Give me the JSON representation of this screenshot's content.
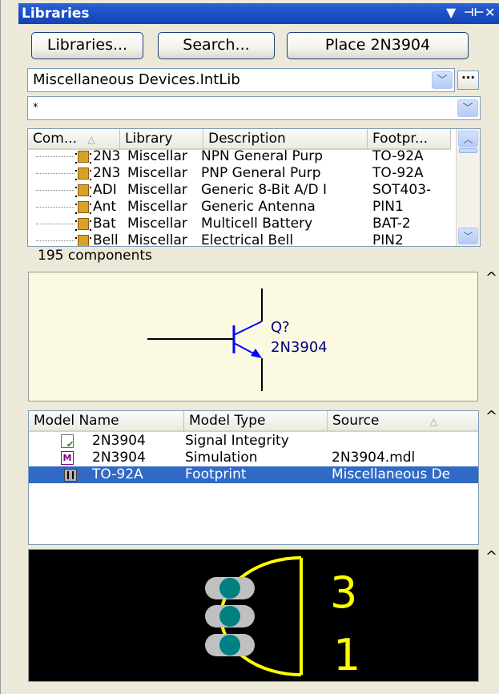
{
  "panel": {
    "title": "Libraries"
  },
  "buttons": {
    "libraries": "Libraries...",
    "search": "Search...",
    "place": "Place 2N3904"
  },
  "library_select": {
    "value": "Miscellaneous Devices.IntLib"
  },
  "filter": {
    "value": "*"
  },
  "components": {
    "columns": [
      "Com...",
      "Library",
      "Description",
      "Footpr..."
    ],
    "rows": [
      {
        "name": "2N3",
        "library": "Miscellar",
        "description": "NPN General Purp",
        "footprint": "TO-92A"
      },
      {
        "name": "2N3",
        "library": "Miscellar",
        "description": "PNP General Purp",
        "footprint": "TO-92A"
      },
      {
        "name": "ADI",
        "library": "Miscellar",
        "description": "Generic 8-Bit A/D I",
        "footprint": "SOT403-"
      },
      {
        "name": "Ant",
        "library": "Miscellar",
        "description": "Generic Antenna",
        "footprint": "PIN1"
      },
      {
        "name": "Bat",
        "library": "Miscellar",
        "description": "Multicell Battery",
        "footprint": "BAT-2"
      },
      {
        "name": "Bell",
        "library": "Miscellar",
        "description": "Electrical Bell",
        "footprint": "PIN2"
      }
    ],
    "count_text": "195 components"
  },
  "schematic": {
    "designator": "Q?",
    "comment": "2N3904"
  },
  "models": {
    "columns": [
      "Model Name",
      "Model Type",
      "Source"
    ],
    "rows": [
      {
        "name": "2N3904",
        "type": "Signal Integrity",
        "source": "",
        "icon": "signal-integrity-icon"
      },
      {
        "name": "2N3904",
        "type": "Simulation",
        "source": "2N3904.mdl",
        "icon": "simulation-model-icon"
      },
      {
        "name": "TO-92A",
        "type": "Footprint",
        "source": "Miscellaneous De",
        "icon": "footprint-icon",
        "selected": true
      }
    ]
  },
  "footprint": {
    "pin_top": "3",
    "pin_bottom": "1"
  },
  "colors": {
    "title_bar": "#1b4fc4",
    "selection": "#316ac5",
    "schematic_bg": "#fcf9e3",
    "schematic_wire": "#0000ff",
    "pcb_bg": "#000000",
    "pcb_silkscreen": "#ffff00",
    "pcb_pad": "#c0c0c0",
    "pcb_hole": "#008080"
  }
}
